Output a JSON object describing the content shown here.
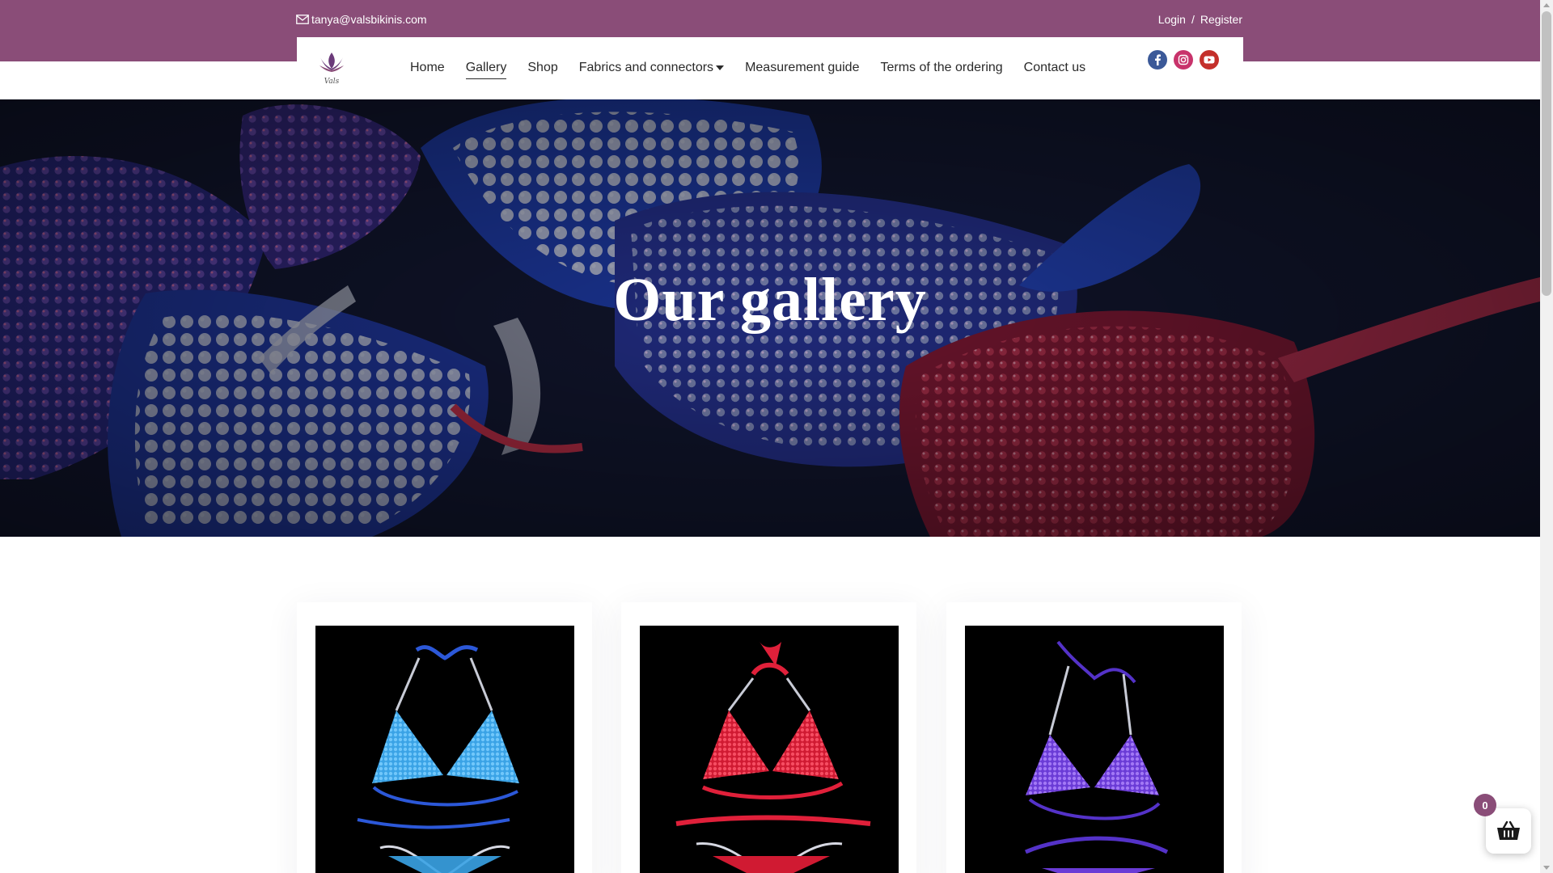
{
  "colors": {
    "brand": "#8a4d78",
    "text": "#2a2a2a",
    "facebook": "#3b5998",
    "instagram": "#c8336b",
    "youtube": "#c4302b"
  },
  "topbar": {
    "email": "tanya@valsbikinis.com",
    "login": "Login",
    "separator": "/",
    "register": "Register"
  },
  "brand": {
    "logo_text": "Vals"
  },
  "nav": {
    "items": [
      {
        "label": "Home"
      },
      {
        "label": "Gallery",
        "active": true
      },
      {
        "label": "Shop"
      },
      {
        "label": "Fabrics and connectors"
      },
      {
        "label": "Measurement guide"
      },
      {
        "label": "Terms of the ordering"
      },
      {
        "label": "Contact us"
      }
    ]
  },
  "social": [
    "facebook-icon",
    "instagram-icon",
    "youtube-icon"
  ],
  "hero": {
    "title": "Our gallery"
  },
  "gallery": {
    "items": [
      {
        "name": "blue crystal bikini",
        "color": "#2a6fd6"
      },
      {
        "name": "red crystal bikini",
        "color": "#c8182a"
      },
      {
        "name": "purple crystal bikini",
        "color": "#6a3bd6"
      }
    ]
  },
  "cart": {
    "count": "0"
  }
}
